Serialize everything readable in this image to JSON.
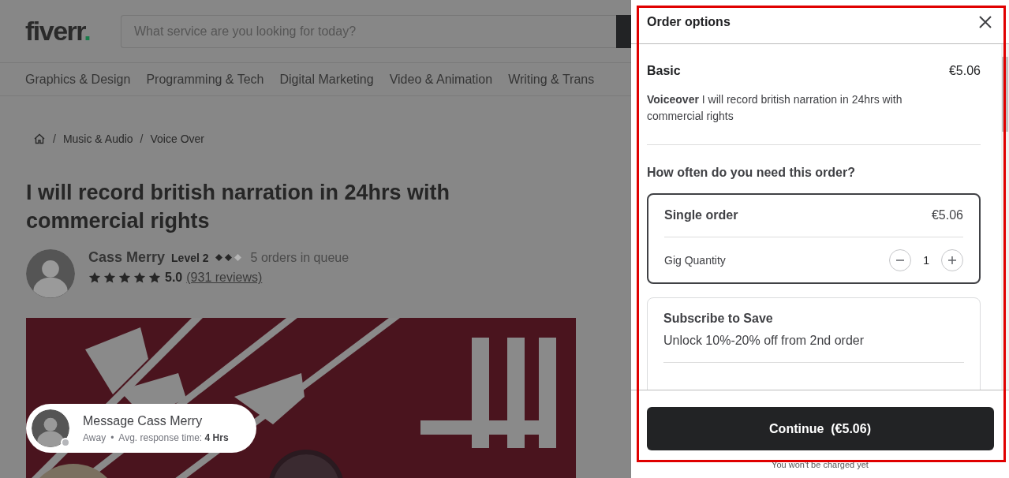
{
  "header": {
    "logo": "fiverr",
    "logo_dot": ".",
    "search": {
      "placeholder": "What service are you looking for today?"
    }
  },
  "categories": [
    "Graphics & Design",
    "Programming & Tech",
    "Digital Marketing",
    "Video & Animation",
    "Writing & Trans"
  ],
  "breadcrumb": [
    {
      "separator": "/",
      "label": "Music & Audio"
    },
    {
      "separator": "/",
      "label": "Voice Over"
    }
  ],
  "gig": {
    "title": "I will record british narration in 24hrs with commercial rights",
    "seller": {
      "name": "Cass Merry",
      "level": "Level 2",
      "level_badge": {
        "stars": 2
      },
      "queue": "5 orders in queue",
      "stars": 5,
      "rating": "5.0",
      "reviews": "(931 reviews)"
    }
  },
  "chat": {
    "title": "Message Cass Merry",
    "online": false,
    "status": "Away",
    "separator": "•",
    "response_label": "Avg. response time:",
    "response_value": "4 Hrs"
  },
  "panel": {
    "title": "Order options",
    "package": {
      "name": "Basic",
      "price": "€5.06",
      "description": "**Voiceover** I will record british narration in 24hrs with commercial rights"
    },
    "question": "How often do you need this order?",
    "options": [
      {
        "kind": "single",
        "title": "Single order",
        "price": "€5.06",
        "selected": true,
        "quantity_label": "Gig Quantity",
        "quantity": "1"
      },
      {
        "kind": "subscription",
        "title": "Subscribe to Save",
        "subtitle": "Unlock 10%-20% off from 2nd order",
        "selected": false
      }
    ],
    "continue_button": "Continue  (€5.06)",
    "note": "You won't be charged yet",
    "highlighted": true
  }
}
